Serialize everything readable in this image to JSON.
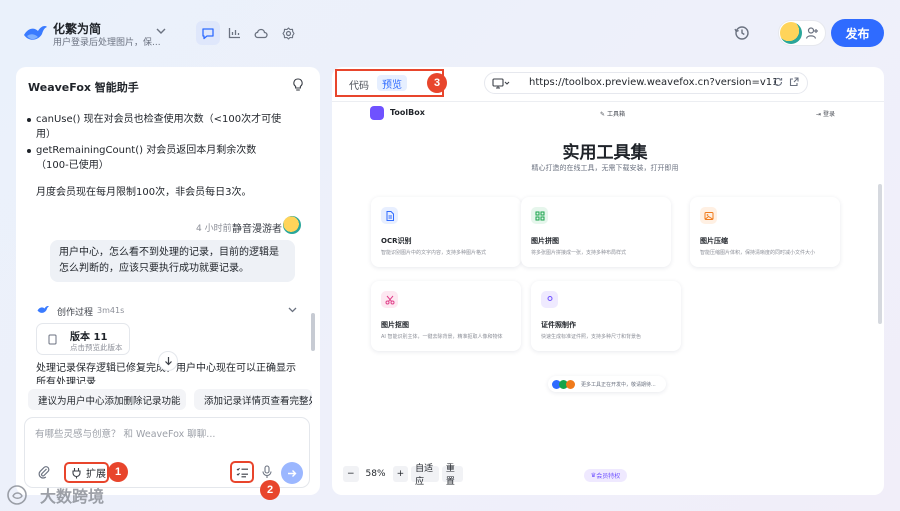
{
  "header": {
    "title": "化繁为简",
    "subtitle": "用户登录后处理图片，保...",
    "publish_label": "发布",
    "tabs": [
      "chat-icon",
      "chart-icon",
      "cloud-icon",
      "settings-icon"
    ]
  },
  "assistant": {
    "title": "WeaveFox  智能助手",
    "bullets": [
      "canUse() 现在对会员也检查使用次数（<100次才可使用）",
      "getRemainingCount() 对会员返回本月剩余次数（100-已使用）"
    ],
    "summary": "月度会员现在每月限制100次，非会员每日3次。",
    "message_time": "4 小时前",
    "user_name": "静音漫游者",
    "user_message": "用户中心，怎么看不到处理的记录，目前的逻辑是怎么判断的，应该只要执行成功就要记录。",
    "process_label": "创作过程",
    "process_time": "3m41s",
    "version_title": "版本 11",
    "version_sub": "点击预览此版本",
    "fix_text": "处理记录保存逻辑已修复完成，用户中心现在可以正确显示所有处理记录",
    "suggestions": [
      "建议为用户中心添加删除记录功能",
      "添加记录详情页查看完整处理"
    ],
    "input_placeholder": "有哪些灵感与创意？ 和 WeaveFox 聊聊...",
    "expand_label": "扩展"
  },
  "annotations": [
    "1",
    "2",
    "3"
  ],
  "watermark": "大数跨境",
  "preview": {
    "tab_code": "代码",
    "tab_preview": "预览",
    "url": "https://toolbox.preview.weavefox.cn?version=v11",
    "site_name": "ToolBox",
    "nav_label": "工具箱",
    "login_label": "登录",
    "hero_title": "实用工具集",
    "hero_sub": "精心打造的在线工具，无需下载安装，打开即用",
    "cards": [
      {
        "title": "OCR识别",
        "desc": "智能识别图片中的文字内容，支持多种图片格式",
        "icon": "document-icon",
        "color": "#2f6bff",
        "bg": "#e8efff"
      },
      {
        "title": "图片拼图",
        "desc": "将多张图片拼接成一张，支持多种布局样式",
        "icon": "grid-icon",
        "color": "#17a34a",
        "bg": "#e6f6ec"
      },
      {
        "title": "图片压缩",
        "desc": "智能压缩图片体积，保持清晰度的同时减小文件大小",
        "icon": "image-icon",
        "color": "#f07a1a",
        "bg": "#fff0e3"
      },
      {
        "title": "图片抠图",
        "desc": "AI 智能识别主体，一键去除背景，精准抠取人像和物体",
        "icon": "scissors-icon",
        "color": "#e0408a",
        "bg": "#fde8f1"
      },
      {
        "title": "证件照制作",
        "desc": "快速生成标准证件照，支持多种尺寸和背景色",
        "icon": "person-icon",
        "color": "#6f52ff",
        "bg": "#efeaff"
      }
    ],
    "more_text": "更多工具正在开发中，敬请期待...",
    "zoom_value": "58%",
    "zoom_minus": "−",
    "zoom_plus": "+",
    "fit_label": "自适应",
    "reset_label": "重置",
    "promo_label": "会员特权"
  }
}
